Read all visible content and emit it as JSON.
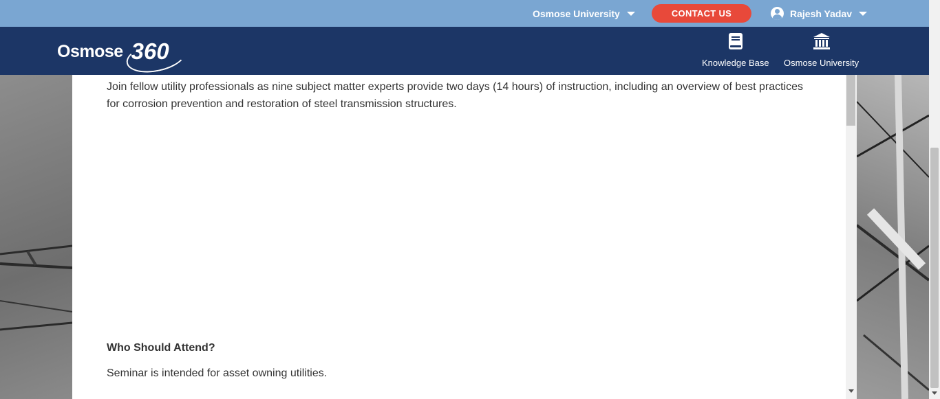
{
  "topbar": {
    "university_menu": "Osmose University",
    "contact_label": "CONTACT US",
    "user_name": "Rajesh Yadav"
  },
  "navbar": {
    "logo_word": "Osmose",
    "logo_number": "360",
    "links": [
      {
        "label": "Knowledge Base",
        "icon": "book-icon"
      },
      {
        "label": "Osmose University",
        "icon": "university-icon"
      }
    ]
  },
  "content": {
    "intro": "Join fellow utility professionals as nine subject matter experts provide two days (14 hours) of instruction, including an overview of best practices for corrosion prevention and restoration of steel transmission structures.",
    "who_heading": "Who Should Attend?",
    "who_text": "Seminar is intended for asset owning utilities."
  },
  "colors": {
    "topbar": "#7aa6d2",
    "navbar": "#1c3666",
    "contact": "#e8493a"
  }
}
